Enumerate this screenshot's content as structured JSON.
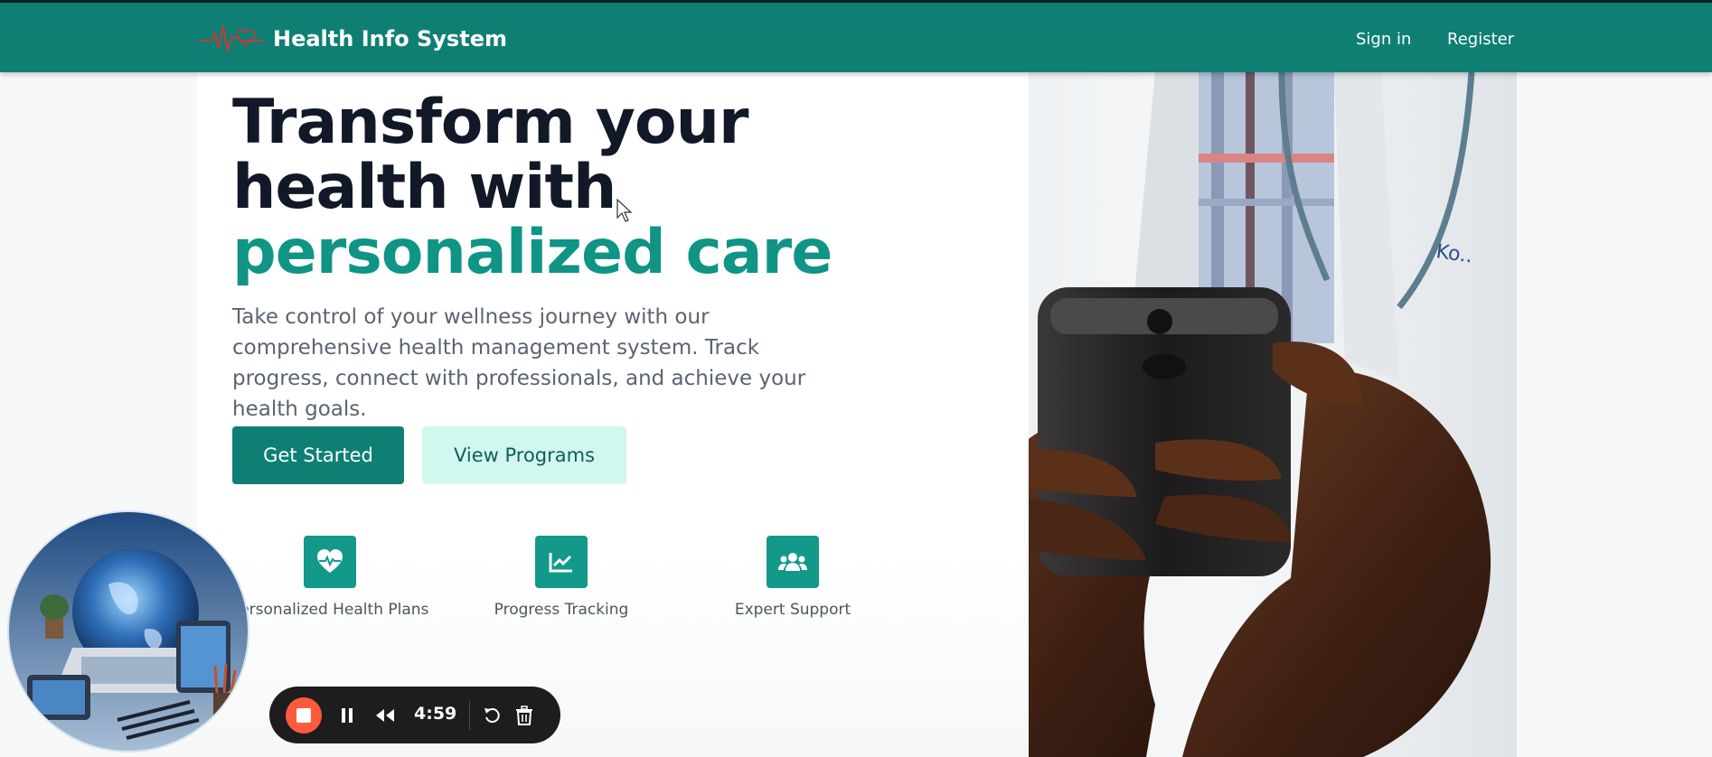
{
  "navbar": {
    "brand_title": "Health Info System",
    "sign_in_label": "Sign in",
    "register_label": "Register",
    "background_color": "#0f7f74",
    "logo_icon": "heartbeat-line-logo"
  },
  "hero": {
    "headline_line1": "Transform your",
    "headline_line2": "health with",
    "headline_accent": "personalized care",
    "lead": "Take control of your wellness journey with our comprehensive health management system. Track progress, connect with professionals, and achieve your health goals.",
    "primary_button": "Get Started",
    "secondary_button": "View Programs",
    "accent_color": "#0f9485"
  },
  "features": [
    {
      "label": "Personalized Health Plans",
      "icon": "heart-pulse-icon"
    },
    {
      "label": "Progress Tracking",
      "icon": "chart-line-icon"
    },
    {
      "label": "Expert Support",
      "icon": "users-icon"
    }
  ],
  "recorder": {
    "time": "4:59",
    "stop_color": "#ff5a3c"
  }
}
